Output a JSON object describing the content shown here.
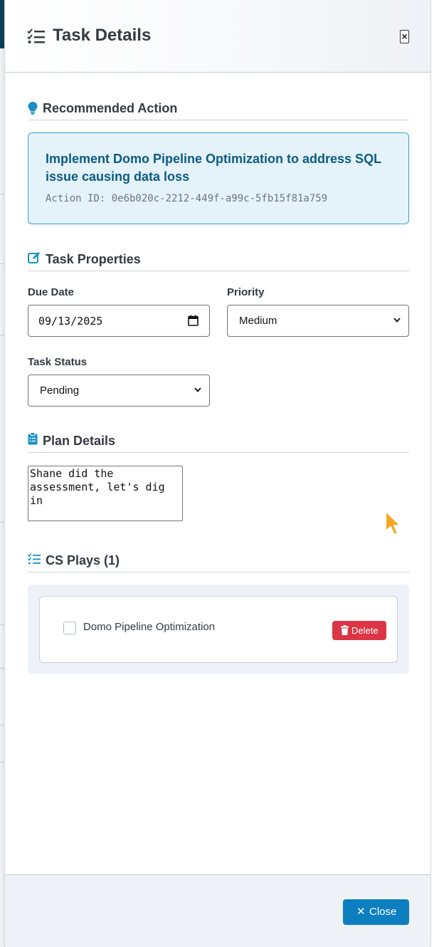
{
  "panel": {
    "title": "Task Details",
    "close_glyph": "×"
  },
  "recommended": {
    "heading": "Recommended Action",
    "action_title": "Implement Domo Pipeline Optimization to address SQL issue causing data loss",
    "action_id": "Action ID: 0e6b020c-2212-449f-a99c-5fb15f81a759"
  },
  "properties": {
    "heading": "Task Properties",
    "due_date_label": "Due Date",
    "due_date_value": "09/13/2025",
    "priority_label": "Priority",
    "priority_value": "Medium",
    "status_label": "Task Status",
    "status_value": "Pending"
  },
  "plan": {
    "heading": "Plan Details",
    "text": "Shane did the\nassessment, let's dig\nin"
  },
  "plays": {
    "heading": "CS Plays (1)",
    "items": [
      {
        "name": "Domo Pipeline Optimization",
        "checked": false,
        "delete_label": "Delete"
      }
    ]
  },
  "footer": {
    "close_label": "Close",
    "close_glyph": "✕"
  },
  "colors": {
    "accent": "#0d7fc0",
    "info_bg": "#e4f3fa",
    "info_border": "#3aa0cc",
    "danger": "#dc3545",
    "cursor": "#f5a623"
  },
  "icons": {
    "title": "tasks-list-icon",
    "recommended": "lightbulb-icon",
    "properties": "edit-icon",
    "plan": "clipboard-icon",
    "plays": "tasks-list-icon",
    "delete": "trash-icon"
  }
}
